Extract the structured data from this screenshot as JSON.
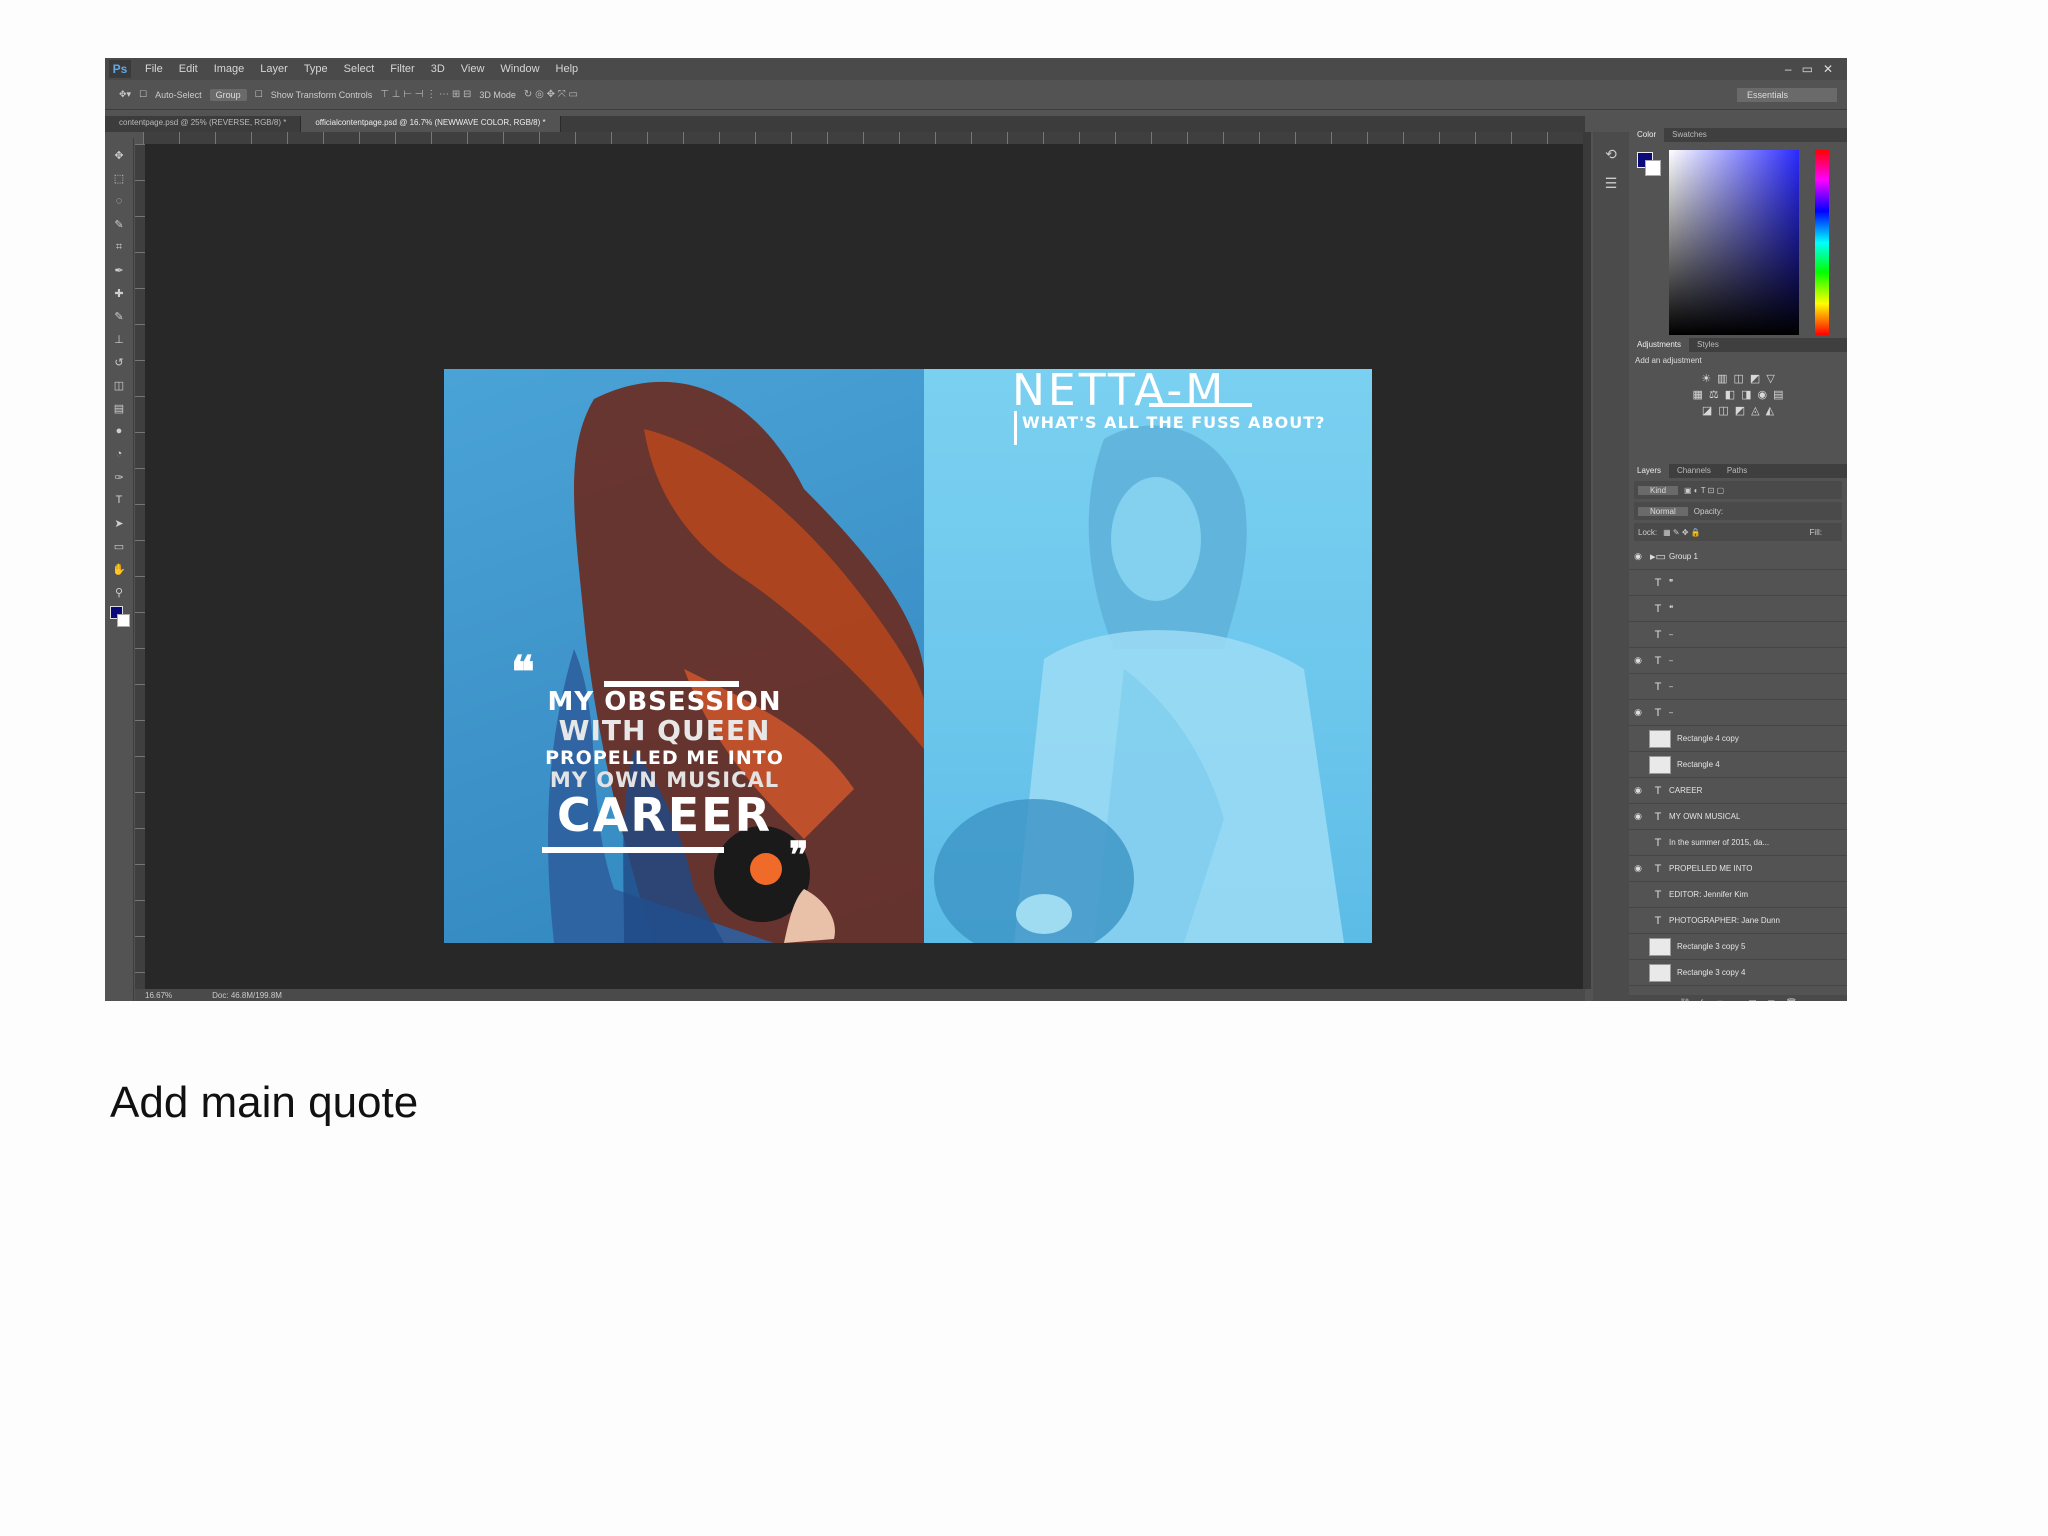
{
  "app": {
    "logo": "Ps",
    "menus": [
      "File",
      "Edit",
      "Image",
      "Layer",
      "Type",
      "Select",
      "Filter",
      "3D",
      "View",
      "Window",
      "Help"
    ],
    "window_controls": [
      "–",
      "▭",
      "✕"
    ]
  },
  "options_bar": {
    "auto_select_label": "Auto-Select",
    "auto_select_value": "Group",
    "transform_label": "Show Transform Controls",
    "mode_label": "3D Mode",
    "workspace": "Essentials"
  },
  "document_tabs": [
    {
      "label": "contentpage.psd @ 25% (REVERSE, RGB/8) *",
      "active": false
    },
    {
      "label": "officialcontentpage.psd @ 16.7% (NEWWAVE COLOR, RGB/8) *",
      "active": true
    }
  ],
  "status": {
    "zoom": "16.67%",
    "doc_size": "Doc: 46.8M/199.8M"
  },
  "spread": {
    "left": {
      "open_quote": "❝",
      "close_quote": "❞",
      "quote_lines": [
        "MY OBSESSION",
        "WITH QUEEN",
        "PROPELLED ME INTO",
        "MY OWN MUSICAL",
        "CAREER"
      ]
    },
    "right": {
      "title": "NETTA-M",
      "tagline": "WHAT'S ALL THE FUSS ABOUT?"
    }
  },
  "panels": {
    "color_tabs": [
      "Color",
      "Swatches"
    ],
    "adjust_tabs": [
      "Adjustments",
      "Styles"
    ],
    "adjust_title": "Add an adjustment",
    "adjust_icons": [
      [
        "☀",
        "▥",
        "◫",
        "◩",
        "▽"
      ],
      [
        "▦",
        "⚖",
        "◧",
        "◨",
        "◉",
        "▤"
      ],
      [
        "◪",
        "◫",
        "◩",
        "◬",
        "◭"
      ]
    ],
    "layers_tabs": [
      "Layers",
      "Channels",
      "Paths"
    ],
    "layer_filter": "Kind",
    "blend_mode": "Normal",
    "opacity_label": "Opacity:",
    "fill_label": "Fill:",
    "lock_label": "Lock:",
    "layers": [
      {
        "name": "Group 1",
        "kind": "group",
        "visible": true
      },
      {
        "name": "❞",
        "kind": "text",
        "visible": false
      },
      {
        "name": "❝",
        "kind": "text",
        "visible": false
      },
      {
        "name": "–",
        "kind": "text",
        "visible": false
      },
      {
        "name": "–",
        "kind": "text",
        "visible": true
      },
      {
        "name": "–",
        "kind": "text",
        "visible": false
      },
      {
        "name": "–",
        "kind": "text",
        "visible": true
      },
      {
        "name": "Rectangle 4 copy",
        "kind": "shape",
        "visible": false
      },
      {
        "name": "Rectangle 4",
        "kind": "shape",
        "visible": false
      },
      {
        "name": "CAREER",
        "kind": "text",
        "visible": true
      },
      {
        "name": "MY OWN MUSICAL",
        "kind": "text",
        "visible": true
      },
      {
        "name": "In the summer of 2015, da...",
        "kind": "text",
        "visible": false
      },
      {
        "name": "PROPELLED ME INTO",
        "kind": "text",
        "visible": true
      },
      {
        "name": "EDITOR: Jennifer Kim",
        "kind": "text",
        "visible": false
      },
      {
        "name": "PHOTOGRAPHER: Jane Dunn",
        "kind": "text",
        "visible": false
      },
      {
        "name": "Rectangle 3 copy 5",
        "kind": "shape",
        "visible": false
      },
      {
        "name": "Rectangle 3 copy 4",
        "kind": "shape",
        "visible": false
      }
    ],
    "layers_footer": [
      "⛓",
      "fx",
      "◘",
      "◐",
      "▣",
      "▢",
      "🗑"
    ]
  },
  "tool_icons": [
    "move-tool",
    "marquee-tool",
    "lasso-tool",
    "quick-select-tool",
    "crop-tool",
    "eyedropper-tool",
    "healing-tool",
    "brush-tool",
    "stamp-tool",
    "history-brush-tool",
    "eraser-tool",
    "gradient-tool",
    "blur-tool",
    "dodge-tool",
    "pen-tool",
    "type-tool",
    "path-select-tool",
    "shape-tool",
    "hand-tool",
    "zoom-tool"
  ],
  "tool_glyphs": [
    "✥",
    "⬚",
    "◌",
    "✎",
    "⌗",
    "✒",
    "✚",
    "✎",
    "⊥",
    "↺",
    "◫",
    "▤",
    "●",
    "◔",
    "✑",
    "T",
    "➤",
    "▭",
    "✋",
    "⚲"
  ],
  "caption": "Add main quote"
}
